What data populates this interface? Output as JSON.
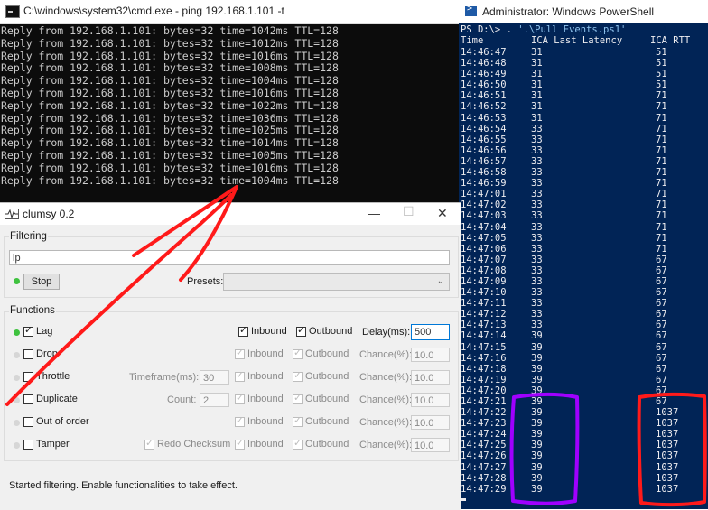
{
  "cmd": {
    "title": "C:\\windows\\system32\\cmd.exe - ping  192.168.1.101 -t",
    "lines": [
      "Reply from 192.168.1.101: bytes=32 time=1042ms TTL=128",
      "Reply from 192.168.1.101: bytes=32 time=1012ms TTL=128",
      "Reply from 192.168.1.101: bytes=32 time=1016ms TTL=128",
      "Reply from 192.168.1.101: bytes=32 time=1008ms TTL=128",
      "Reply from 192.168.1.101: bytes=32 time=1004ms TTL=128",
      "Reply from 192.168.1.101: bytes=32 time=1016ms TTL=128",
      "Reply from 192.168.1.101: bytes=32 time=1022ms TTL=128",
      "Reply from 192.168.1.101: bytes=32 time=1036ms TTL=128",
      "Reply from 192.168.1.101: bytes=32 time=1025ms TTL=128",
      "Reply from 192.168.1.101: bytes=32 time=1014ms TTL=128",
      "Reply from 192.168.1.101: bytes=32 time=1005ms TTL=128",
      "Reply from 192.168.1.101: bytes=32 time=1016ms TTL=128",
      "Reply from 192.168.1.101: bytes=32 time=1004ms TTL=128"
    ]
  },
  "powershell": {
    "title": "Administrator: Windows PowerShell",
    "prompt": "PS D:\\> . ",
    "command": "'.\\Pull Events.ps1'",
    "headers": {
      "time": "Time",
      "latency": "ICA Last Latency",
      "rtt": "ICA RTT"
    },
    "rows": [
      [
        "14:46:47",
        "31",
        "51"
      ],
      [
        "14:46:48",
        "31",
        "51"
      ],
      [
        "14:46:49",
        "31",
        "51"
      ],
      [
        "14:46:50",
        "31",
        "51"
      ],
      [
        "14:46:51",
        "31",
        "71"
      ],
      [
        "14:46:52",
        "31",
        "71"
      ],
      [
        "14:46:53",
        "31",
        "71"
      ],
      [
        "14:46:54",
        "33",
        "71"
      ],
      [
        "14:46:55",
        "33",
        "71"
      ],
      [
        "14:46:56",
        "33",
        "71"
      ],
      [
        "14:46:57",
        "33",
        "71"
      ],
      [
        "14:46:58",
        "33",
        "71"
      ],
      [
        "14:46:59",
        "33",
        "71"
      ],
      [
        "14:47:01",
        "33",
        "71"
      ],
      [
        "14:47:02",
        "33",
        "71"
      ],
      [
        "14:47:03",
        "33",
        "71"
      ],
      [
        "14:47:04",
        "33",
        "71"
      ],
      [
        "14:47:05",
        "33",
        "71"
      ],
      [
        "14:47:06",
        "33",
        "71"
      ],
      [
        "14:47:07",
        "33",
        "67"
      ],
      [
        "14:47:08",
        "33",
        "67"
      ],
      [
        "14:47:09",
        "33",
        "67"
      ],
      [
        "14:47:10",
        "33",
        "67"
      ],
      [
        "14:47:11",
        "33",
        "67"
      ],
      [
        "14:47:12",
        "33",
        "67"
      ],
      [
        "14:47:13",
        "33",
        "67"
      ],
      [
        "14:47:14",
        "39",
        "67"
      ],
      [
        "14:47:15",
        "39",
        "67"
      ],
      [
        "14:47:16",
        "39",
        "67"
      ],
      [
        "14:47:18",
        "39",
        "67"
      ],
      [
        "14:47:19",
        "39",
        "67"
      ],
      [
        "14:47:20",
        "39",
        "67"
      ],
      [
        "14:47:21",
        "39",
        "67"
      ],
      [
        "14:47:22",
        "39",
        "1037"
      ],
      [
        "14:47:23",
        "39",
        "1037"
      ],
      [
        "14:47:24",
        "39",
        "1037"
      ],
      [
        "14:47:25",
        "39",
        "1037"
      ],
      [
        "14:47:26",
        "39",
        "1037"
      ],
      [
        "14:47:27",
        "39",
        "1037"
      ],
      [
        "14:47:28",
        "39",
        "1037"
      ],
      [
        "14:47:29",
        "39",
        "1037"
      ]
    ]
  },
  "clumsy": {
    "title": "clumsy 0.2",
    "filtering": {
      "legend": "Filtering",
      "filter_value": "ip",
      "stop_label": "Stop",
      "presets_label": "Presets:",
      "presets_value": ""
    },
    "functions": {
      "legend": "Functions",
      "inbound_label": "Inbound",
      "outbound_label": "Outbound",
      "lag": {
        "label": "Lag",
        "param_label": "Delay(ms):",
        "param_value": "500"
      },
      "drop": {
        "label": "Drop",
        "param_label": "Chance(%):",
        "param_value": "10.0"
      },
      "throttle": {
        "label": "Throttle",
        "extra_label": "Timeframe(ms):",
        "extra_value": "30",
        "param_label": "Chance(%):",
        "param_value": "10.0"
      },
      "duplicate": {
        "label": "Duplicate",
        "extra_label": "Count:",
        "extra_value": "2",
        "param_label": "Chance(%):",
        "param_value": "10.0"
      },
      "out_of_order": {
        "label": "Out of order",
        "param_label": "Chance(%):",
        "param_value": "10.0"
      },
      "tamper": {
        "label": "Tamper",
        "extra_label": "Redo Checksum",
        "param_label": "Chance(%):",
        "param_value": "10.0"
      }
    },
    "status": "Started filtering. Enable functionalities to take effect."
  },
  "colors": {
    "cmd_bg": "#0c0c0c",
    "cmd_text": "#cccccc",
    "ps_bg": "#012456",
    "ps_text": "#eeedf0",
    "annotation_red": "#ff1a1a",
    "annotation_purple": "#a000ff",
    "status_on": "#3fc23f"
  },
  "icons": {
    "cmd": "console-icon",
    "powershell": "powershell-icon",
    "clumsy": "waveform-icon"
  }
}
